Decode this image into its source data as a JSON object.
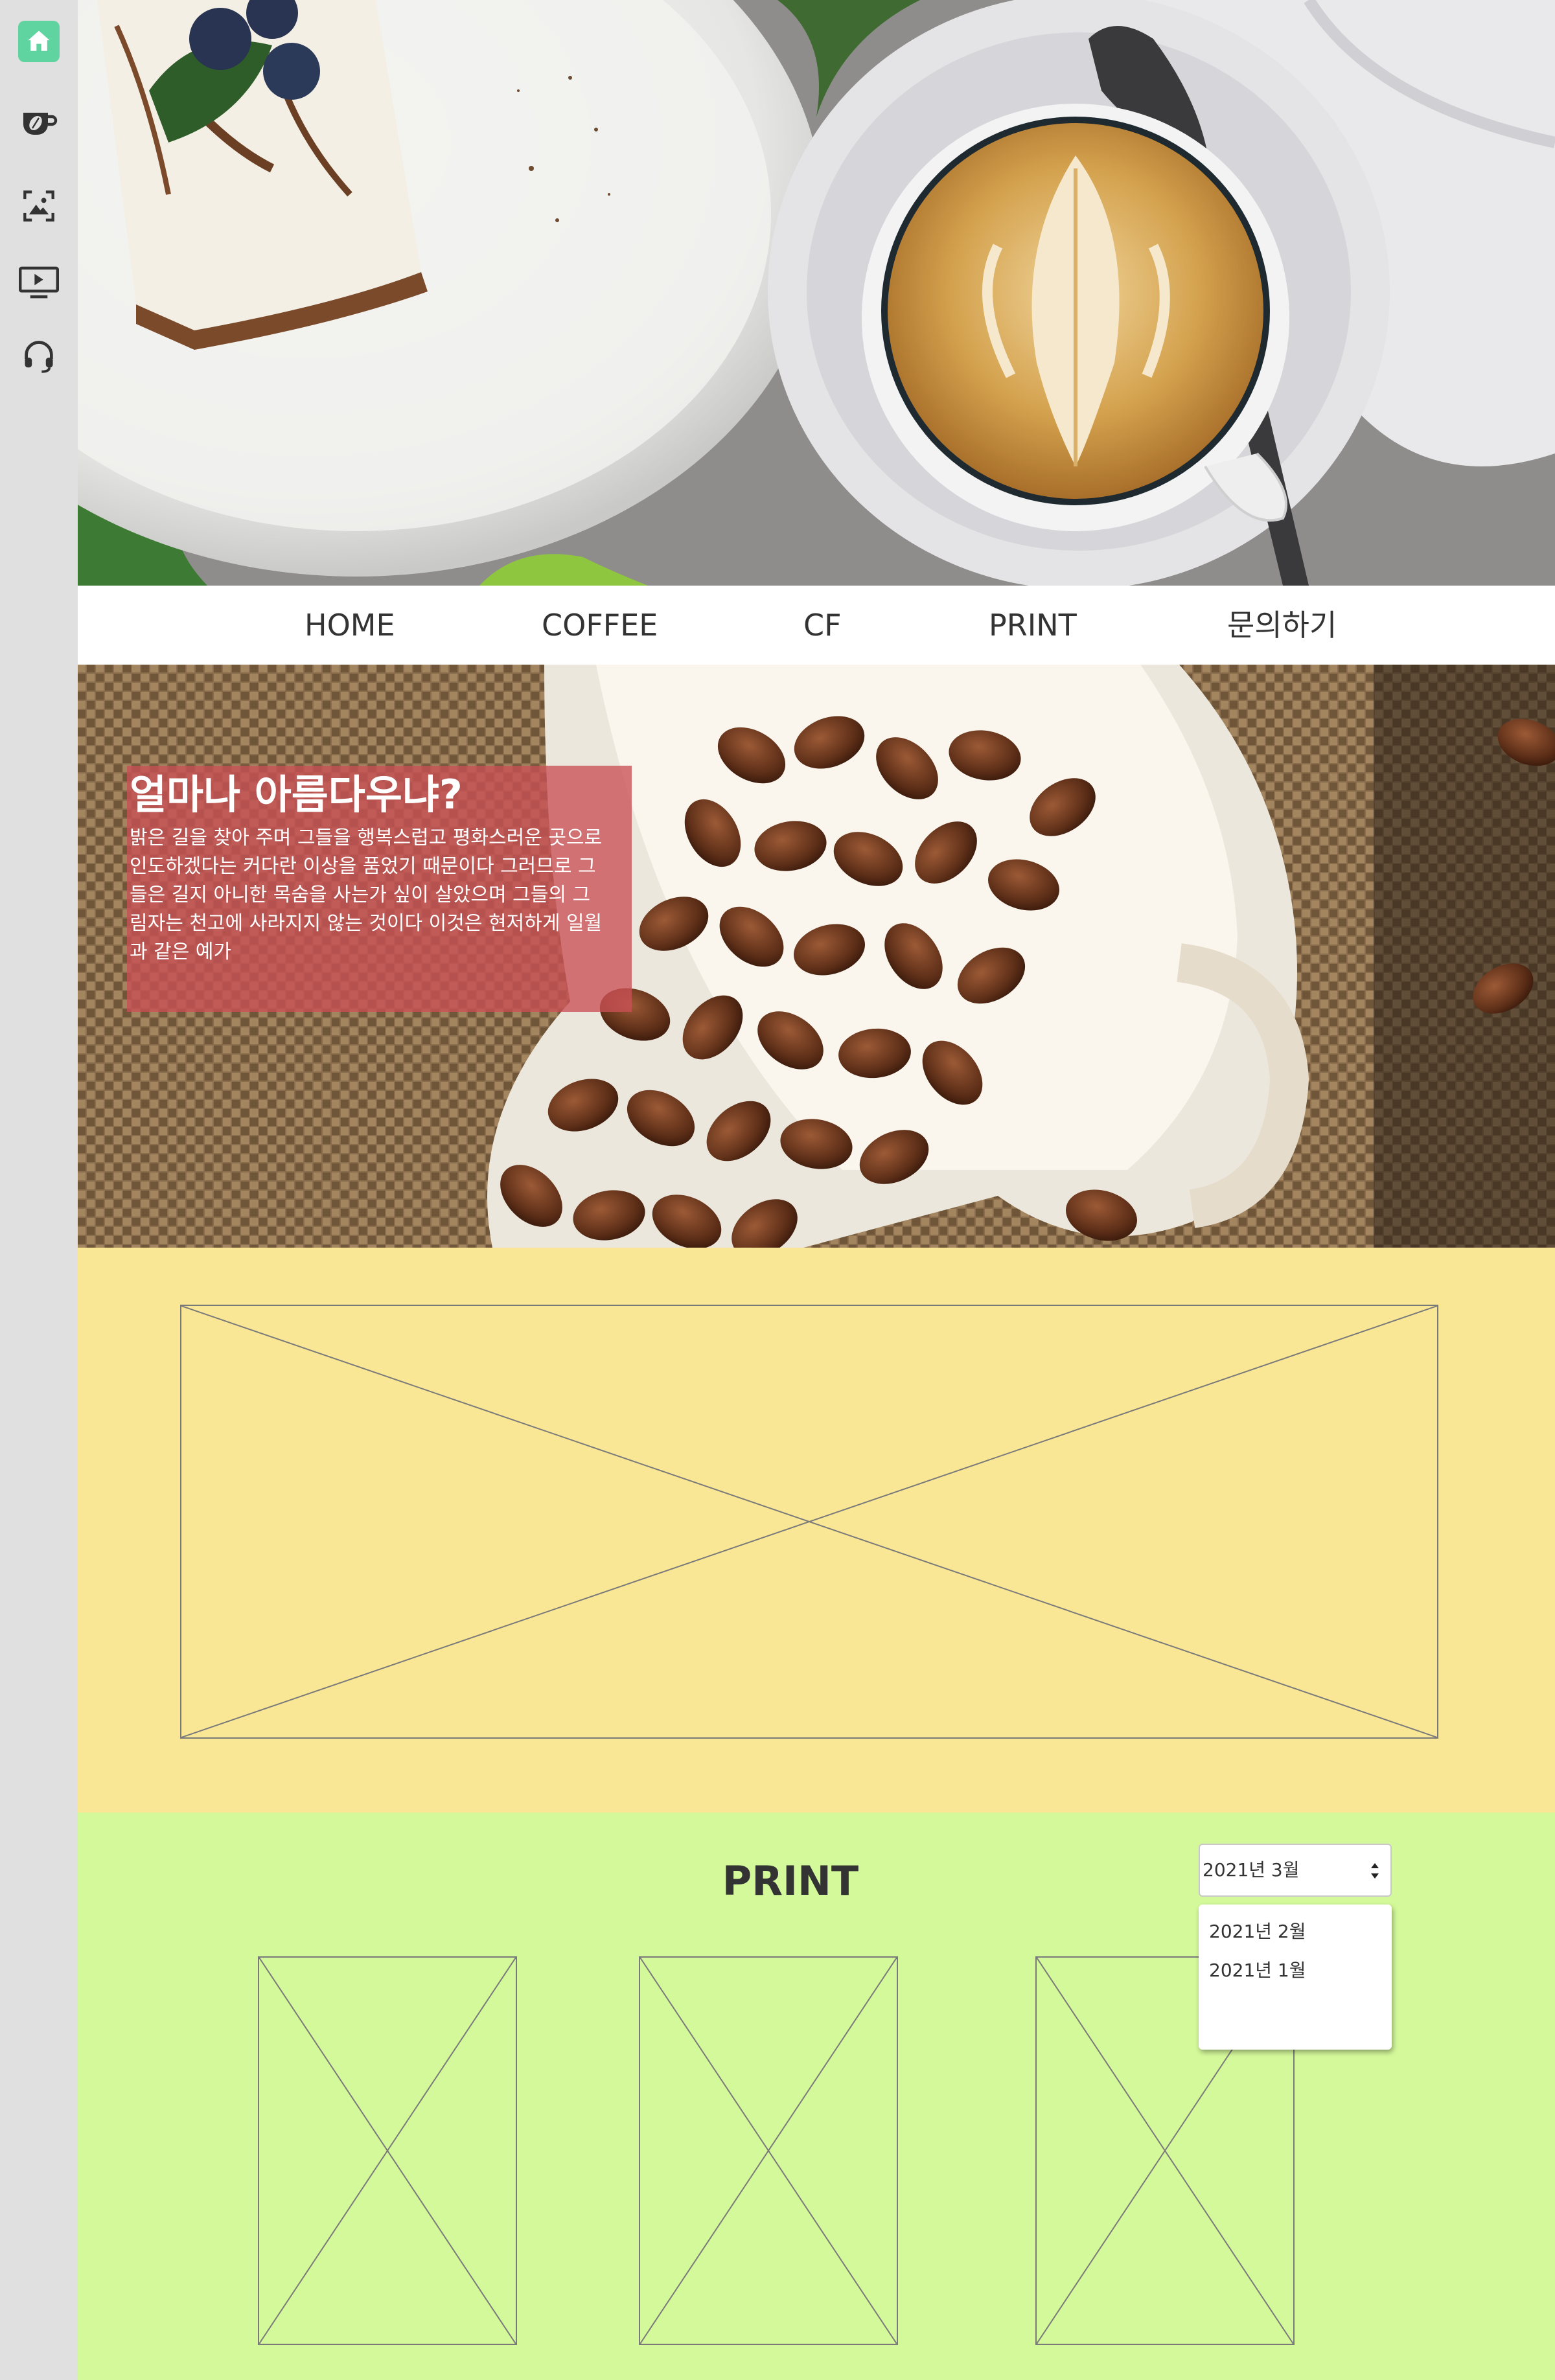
{
  "sidebar": {
    "items": [
      {
        "icon": "home-icon",
        "active": true
      },
      {
        "icon": "coffee-cup-icon",
        "active": false
      },
      {
        "icon": "image-gallery-icon",
        "active": false
      },
      {
        "icon": "video-player-icon",
        "active": false
      },
      {
        "icon": "headset-icon",
        "active": false
      }
    ],
    "accent_color": "#5fd3a0"
  },
  "nav": {
    "items": [
      {
        "label": "HOME"
      },
      {
        "label": "COFFEE"
      },
      {
        "label": "CF"
      },
      {
        "label": "PRINT"
      },
      {
        "label": "문의하기"
      }
    ]
  },
  "banner": {
    "title": "얼마나 아름다우냐?",
    "body_lines": [
      "밝은 길을 찾아 주며 그들을 행복스럽고 평화스러운 곳으로",
      "인도하겠다는 커다란 이상을 품었기 때문이다 그러므로 그",
      "들은 길지 아니한 목숨을 사는가 싶이 살았으며 그들의 그",
      "림자는 천고에 사라지지 않는 것이다 이것은 현저하게 일월",
      "과 같은 예가"
    ],
    "card_color": "#c95054"
  },
  "print_section": {
    "title": "PRINT",
    "month_select": {
      "selected": "2021년 3월",
      "options": [
        "2021년 2월",
        "2021년 1월"
      ]
    }
  },
  "colors": {
    "yellow_section": "#f9e795",
    "green_section": "#d4f99a",
    "sidebar_bg": "#e0e0e0"
  }
}
